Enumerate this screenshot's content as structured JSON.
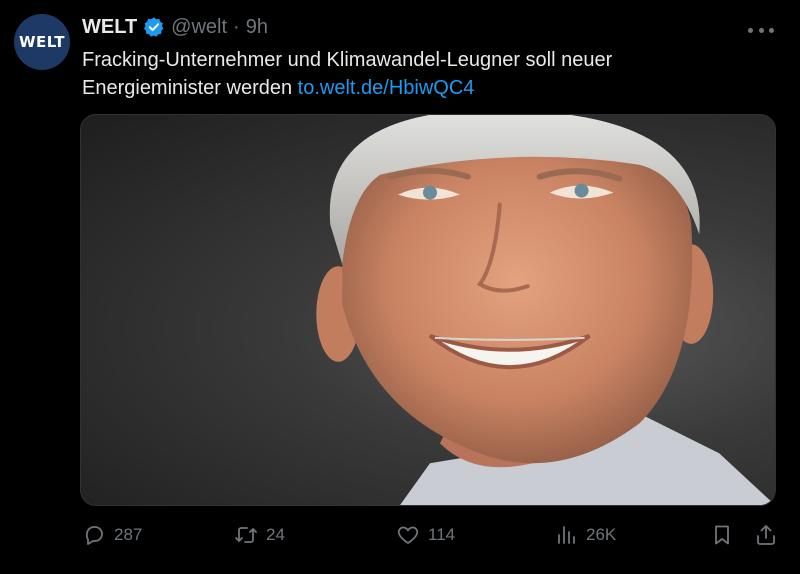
{
  "author": {
    "avatar_text": "WELT",
    "name": "WELT",
    "handle": "@welt",
    "separator": "·",
    "time": "9h"
  },
  "tweet": {
    "text": "Fracking-Unternehmer und Klimawandel-Leugner soll neuer Energieminister werden",
    "link": "to.welt.de/HbiwQC4"
  },
  "stats": {
    "replies": "287",
    "retweets": "24",
    "likes": "114",
    "views": "26K"
  },
  "colors": {
    "background": "#000000",
    "link": "#1d9bf0",
    "verified": "#1d9bf0",
    "muted": "#71767b"
  },
  "icons": {
    "reply": "speech-bubble-icon",
    "retweet": "retweet-arrows-icon",
    "like": "heart-icon",
    "views": "bar-chart-icon",
    "bookmark": "bookmark-icon",
    "share": "share-upload-icon",
    "more": "ellipsis-icon"
  }
}
